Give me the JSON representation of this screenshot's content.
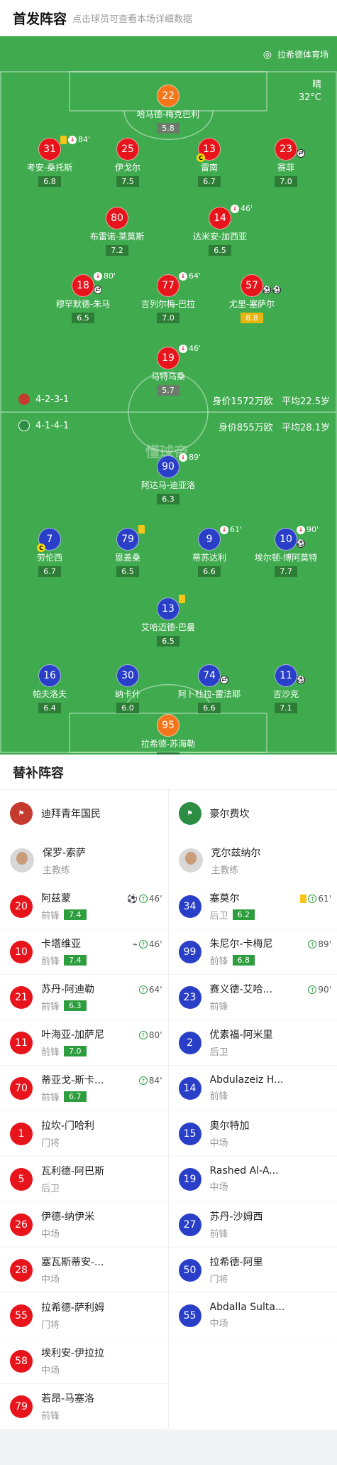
{
  "header": {
    "title": "首发阵容",
    "subtitle": "点击球员可查看本场详细数据"
  },
  "pitch": {
    "venue": "拉希德体育场",
    "weather": "晴",
    "temp": "32°C",
    "home_formation": "4-2-3-1",
    "home_value": "身价1572万欧",
    "home_age": "平均22.5岁",
    "away_formation": "4-1-4-1",
    "away_value": "身价855万欧",
    "away_age": "平均28.1岁",
    "watermark": "懂球帝",
    "home": [
      {
        "n": "22",
        "name": "哈马德-梅克巴利",
        "r": "5.8",
        "c": "org",
        "rg": "gray"
      },
      {
        "n": "31",
        "name": "考安-桑托斯",
        "r": "6.8",
        "c": "red",
        "yc": true,
        "sub": "84'"
      },
      {
        "n": "25",
        "name": "伊戈尔",
        "r": "7.5",
        "c": "red"
      },
      {
        "n": "13",
        "name": "雷南",
        "r": "6.7",
        "c": "red",
        "cap": true
      },
      {
        "n": "23",
        "name": "赛菲",
        "r": "7.0",
        "c": "red",
        "sw": true
      },
      {
        "n": "80",
        "name": "布雷诺-莱莫斯",
        "r": "7.2",
        "c": "red"
      },
      {
        "n": "14",
        "name": "达米安-加西亚",
        "r": "6.5",
        "c": "red",
        "sub": "46'"
      },
      {
        "n": "18",
        "name": "穆罕默德-朱马",
        "r": "6.5",
        "c": "red",
        "sub": "80'",
        "sw": true
      },
      {
        "n": "77",
        "name": "吉列尔梅-巴拉",
        "r": "7.0",
        "c": "red",
        "sub": "64'"
      },
      {
        "n": "57",
        "name": "尤里-塞萨尔",
        "r": "8.8",
        "c": "red",
        "goals": 2,
        "rg": "gold"
      },
      {
        "n": "19",
        "name": "马特乌桑",
        "r": "5.7",
        "c": "red",
        "sub": "46'",
        "rg": "gray"
      }
    ],
    "away": [
      {
        "n": "90",
        "name": "阿达马-迪亚洛",
        "r": "6.3",
        "c": "blue",
        "sub": "89'"
      },
      {
        "n": "7",
        "name": "劳伦西",
        "r": "6.7",
        "c": "blue",
        "cap": true
      },
      {
        "n": "79",
        "name": "恩盖桑",
        "r": "6.5",
        "c": "blue",
        "yc": true
      },
      {
        "n": "9",
        "name": "蒂苏达利",
        "r": "6.6",
        "c": "blue",
        "sub": "61'"
      },
      {
        "n": "10",
        "name": "埃尔顿-博阿莫特",
        "r": "7.7",
        "c": "blue",
        "sub": "90'",
        "goals": 1
      },
      {
        "n": "13",
        "name": "艾哈迈德-巴曼",
        "r": "6.5",
        "c": "blue",
        "yc": true
      },
      {
        "n": "16",
        "name": "帕夫洛夫",
        "r": "6.4",
        "c": "blue"
      },
      {
        "n": "30",
        "name": "纳卡什",
        "r": "6.0",
        "c": "blue"
      },
      {
        "n": "74",
        "name": "阿卜杜拉-雷法耶",
        "r": "6.6",
        "c": "blue",
        "sw": true
      },
      {
        "n": "11",
        "name": "吉沙克",
        "r": "7.1",
        "c": "blue",
        "goals": 1
      },
      {
        "n": "95",
        "name": "拉希德-苏海勒",
        "r": "6.4",
        "c": "org"
      }
    ]
  },
  "subs": {
    "title": "替补阵容",
    "home_team": "迪拜青年国民",
    "away_team": "豪尔费坎",
    "home_coach": "保罗-索萨",
    "away_coach": "克尔兹纳尔",
    "coach_role": "主教练",
    "home_list": [
      {
        "n": "20",
        "name": "阿兹蒙",
        "pos": "前锋",
        "r": "7.4",
        "ev": "46'",
        "ball": true
      },
      {
        "n": "10",
        "name": "卡塔维亚",
        "pos": "前锋",
        "r": "7.4",
        "ev": "46'",
        "boot": true
      },
      {
        "n": "21",
        "name": "苏丹-阿迪勒",
        "pos": "前锋",
        "r": "6.3",
        "ev": "64'"
      },
      {
        "n": "11",
        "name": "叶海亚-加萨尼",
        "pos": "前锋",
        "r": "7.0",
        "ev": "80'"
      },
      {
        "n": "70",
        "name": "蒂亚戈-斯卡...",
        "pos": "前锋",
        "r": "6.7",
        "ev": "84'"
      },
      {
        "n": "1",
        "name": "拉坎-门哈利",
        "pos": "门将"
      },
      {
        "n": "5",
        "name": "瓦利德-阿巴斯",
        "pos": "后卫"
      },
      {
        "n": "26",
        "name": "伊德-纳伊米",
        "pos": "中场"
      },
      {
        "n": "28",
        "name": "塞瓦斯蒂安-...",
        "pos": "中场"
      },
      {
        "n": "55",
        "name": "拉希德-萨利姆",
        "pos": "门将"
      },
      {
        "n": "58",
        "name": "埃利安-伊拉拉",
        "pos": "中场"
      },
      {
        "n": "79",
        "name": "若昂-马塞洛",
        "pos": "前锋"
      }
    ],
    "away_list": [
      {
        "n": "34",
        "name": "塞莫尔",
        "pos": "后卫",
        "r": "6.2",
        "ev": "61'",
        "yc": true
      },
      {
        "n": "99",
        "name": "朱尼尔-卡梅尼",
        "pos": "前锋",
        "r": "6.8",
        "ev": "89'"
      },
      {
        "n": "23",
        "name": "赛义德-艾哈...",
        "pos": "前锋",
        "ev": "90'"
      },
      {
        "n": "2",
        "name": "优素福-阿米里",
        "pos": "后卫"
      },
      {
        "n": "14",
        "name": "Abdulazeiz H...",
        "pos": "前锋"
      },
      {
        "n": "15",
        "name": "奥尔特加",
        "pos": "中场"
      },
      {
        "n": "19",
        "name": "Rashed Al-A...",
        "pos": "中场"
      },
      {
        "n": "27",
        "name": "苏丹-沙姆西",
        "pos": "前锋"
      },
      {
        "n": "50",
        "name": "拉希德-阿里",
        "pos": "门将"
      },
      {
        "n": "55",
        "name": "Abdalla Sulta...",
        "pos": "中场"
      }
    ]
  }
}
